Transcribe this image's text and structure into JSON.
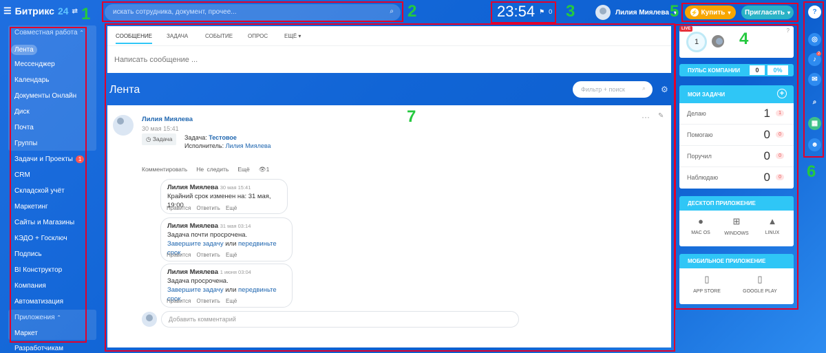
{
  "header": {
    "logo_main": "Битрикс",
    "logo_num": "24",
    "search_placeholder": "искать сотрудника, документ, прочее...",
    "clock": "23:54",
    "flag_count": "0",
    "user_name": "Лилия Миялева",
    "buy_label": "Купить",
    "invite_label": "Пригласить"
  },
  "sidebar": {
    "section1": "Совместная работа",
    "section2": "Приложения",
    "items": [
      "Лента",
      "Мессенджер",
      "Календарь",
      "Документы Онлайн",
      "Диск",
      "Почта",
      "Группы",
      "Задачи и Проекты",
      "CRM",
      "Складской учёт",
      "Маркетинг",
      "Сайты и Магазины",
      "КЭДО + Госключ",
      "Подпись",
      "BI Конструктор",
      "Компания",
      "Автоматизация"
    ],
    "tasks_badge": "1",
    "apps_items": [
      "Маркет",
      "Разработчикам"
    ]
  },
  "form": {
    "tabs": [
      "Сообщение",
      "Задача",
      "Событие",
      "Опрос",
      "Ещё"
    ],
    "placeholder": "Написать сообщение ..."
  },
  "feed": {
    "title": "Лента",
    "filter_placeholder": "Фильтр + поиск"
  },
  "post": {
    "author": "Лилия Миялева",
    "date": "30 мая 15:41",
    "tag": "Задача",
    "task_label": "Задача:",
    "task_name": "Тестовое",
    "executor_label": "Исполнитель:",
    "executor_name": "Лилия Миялева",
    "actions": [
      "Комментировать",
      "Не следить",
      "Ещё"
    ],
    "views": "1",
    "comments": [
      {
        "author": "Лилия Миялева",
        "time": "30 мая 15:41",
        "line1": "Крайний срок изменен на: 31 мая, 19:00",
        "link1": "",
        "mid": "",
        "link2": ""
      },
      {
        "author": "Лилия Миялева",
        "time": "31 мая 03:14",
        "line1": "Задача почти просрочена.",
        "link1": "Завершите задачу",
        "mid": " или ",
        "link2": "передвиньте срок."
      },
      {
        "author": "Лилия Миялева",
        "time": "1 июня 03:04",
        "line1": "Задача просрочена.",
        "link1": "Завершите задачу",
        "mid": " или ",
        "link2": "передвиньте срок."
      }
    ],
    "comment_actions": [
      "Нравится",
      "Ответить",
      "Ещё"
    ],
    "add_comment": "Добавить комментарий"
  },
  "right": {
    "live": "LIVE",
    "live_count": "1",
    "pulse_label": "ПУЛЬС КОМПАНИИ",
    "pulse_value": "0",
    "pulse_percent": "0%",
    "tasks_title": "МОИ ЗАДАЧИ",
    "tasks": [
      {
        "label": "Делаю",
        "num": "1",
        "count": "1"
      },
      {
        "label": "Помогаю",
        "num": "0",
        "count": "0"
      },
      {
        "label": "Поручил",
        "num": "0",
        "count": "0"
      },
      {
        "label": "Наблюдаю",
        "num": "0",
        "count": "0"
      }
    ],
    "desktop_title": "ДЕСКТОП ПРИЛОЖЕНИЕ",
    "desktop": [
      "MAC OS",
      "WINDOWS",
      "LINUX"
    ],
    "mobile_title": "МОБИЛЬНОЕ ПРИЛОЖЕНИЕ",
    "mobile": [
      "APP STORE",
      "GOOGLE PLAY"
    ],
    "notif_badge": "2"
  },
  "annotations": [
    "1",
    "2",
    "3",
    "4",
    "5",
    "6",
    "7"
  ],
  "colors": {
    "accent": "#2fc6f6",
    "annotation_box": "#e2002b",
    "annotation_num": "#25c93f"
  }
}
